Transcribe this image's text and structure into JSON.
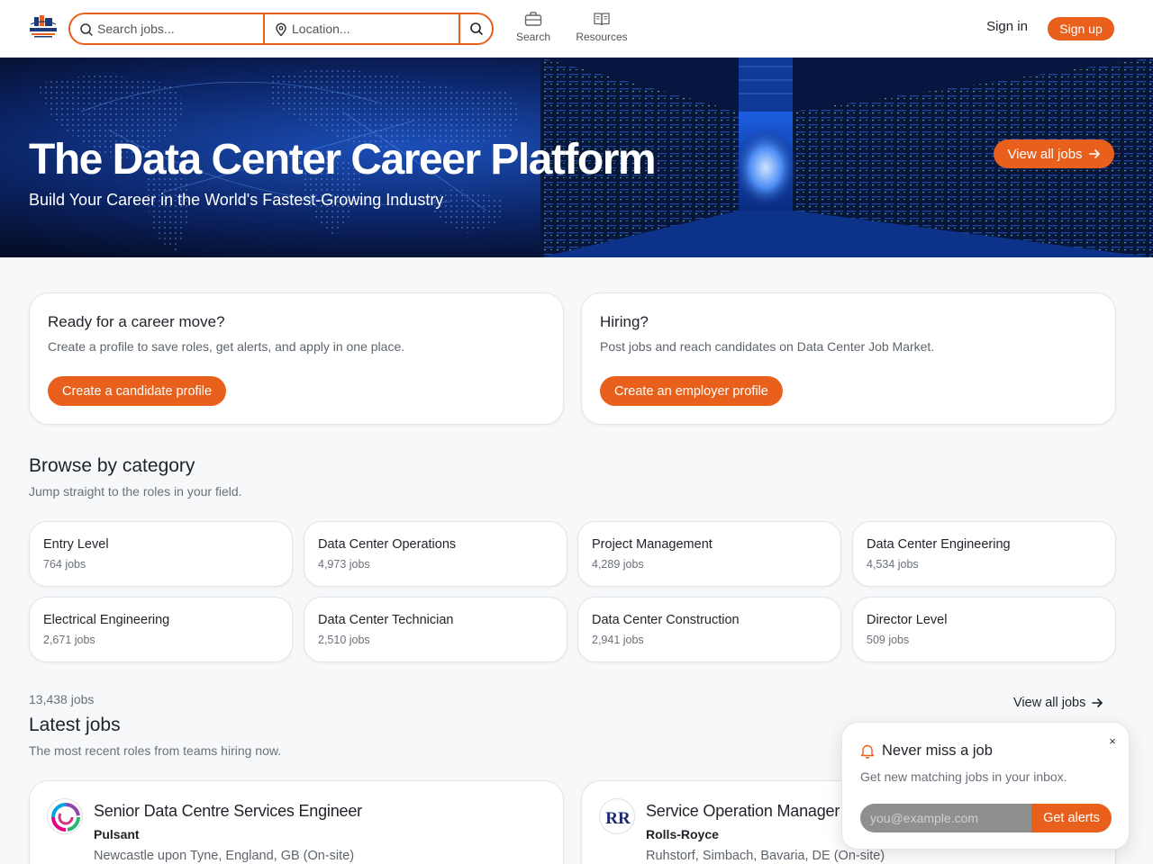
{
  "header": {
    "search_placeholder": "Search jobs...",
    "location_placeholder": "Location...",
    "nav": [
      {
        "label": "Search",
        "icon": "briefcase-icon"
      },
      {
        "label": "Resources",
        "icon": "book-icon"
      }
    ],
    "sign_in": "Sign in",
    "sign_up": "Sign up"
  },
  "hero": {
    "title": "The Data Center Career Platform",
    "subtitle": "Build Your Career in the World's Fastest-Growing Industry",
    "button": "View all jobs"
  },
  "cta": {
    "candidate": {
      "title": "Ready for a career move?",
      "text": "Create a profile to save roles, get alerts, and apply in one place.",
      "button": "Create a candidate profile"
    },
    "employer": {
      "title": "Hiring?",
      "text": "Post jobs and reach candidates on Data Center Job Market.",
      "button": "Create an employer profile"
    }
  },
  "categories": {
    "title": "Browse by category",
    "subtitle": "Jump straight to the roles in your field.",
    "items": [
      {
        "name": "Entry Level",
        "count": "764 jobs"
      },
      {
        "name": "Data Center Operations",
        "count": "4,973 jobs"
      },
      {
        "name": "Project Management",
        "count": "4,289 jobs"
      },
      {
        "name": "Data Center Engineering",
        "count": "4,534 jobs"
      },
      {
        "name": "Electrical Engineering",
        "count": "2,671 jobs"
      },
      {
        "name": "Data Center Technician",
        "count": "2,510 jobs"
      },
      {
        "name": "Data Center Construction",
        "count": "2,941 jobs"
      },
      {
        "name": "Director Level",
        "count": "509 jobs"
      }
    ]
  },
  "latest": {
    "count": "13,438 jobs",
    "title": "Latest jobs",
    "subtitle": "The most recent roles from teams hiring now.",
    "view_all": "View all jobs",
    "jobs": [
      {
        "title": "Senior Data Centre Services Engineer",
        "company": "Pulsant",
        "location": "Newcastle upon Tyne, England, GB (On-site)"
      },
      {
        "title": "Service Operation Manager",
        "company": "Rolls-Royce",
        "location": "Ruhstorf, Simbach, Bavaria, DE (On-site)"
      }
    ]
  },
  "alert_popup": {
    "title": "Never miss a job",
    "subtitle": "Get new matching jobs in your inbox.",
    "email_placeholder": "you@example.com",
    "button": "Get alerts",
    "close": "×"
  },
  "colors": {
    "accent": "#e8601c",
    "hero_bg": "#061330",
    "text": "#1f2329"
  }
}
